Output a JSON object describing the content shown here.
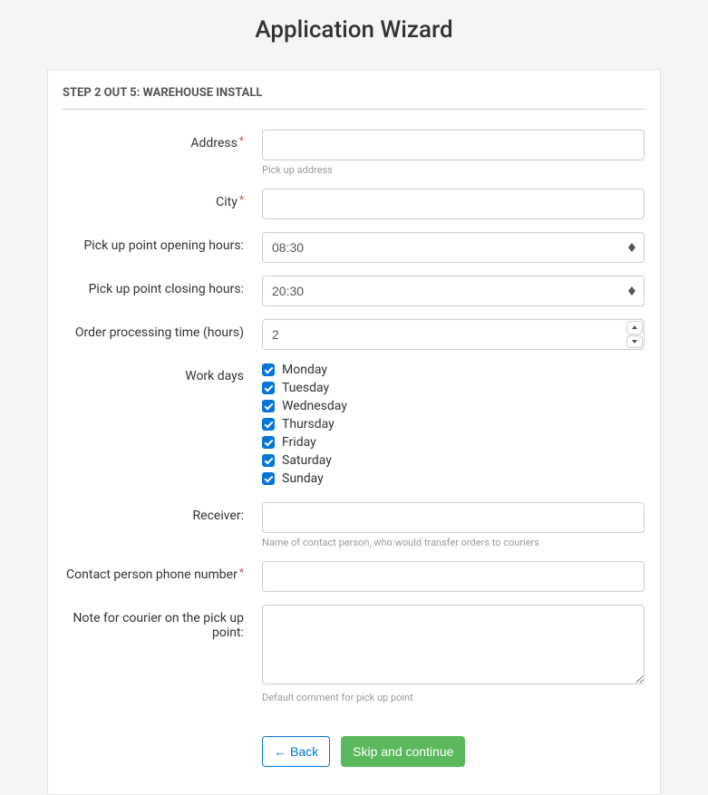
{
  "page_title": "Application Wizard",
  "step_header": "STEP 2 OUT 5: WAREHOUSE INSTALL",
  "form": {
    "address": {
      "label": "Address",
      "required": true,
      "value": "",
      "help": "Pick up address"
    },
    "city": {
      "label": "City",
      "required": true,
      "value": ""
    },
    "opening_hours": {
      "label": "Pick up point opening hours:",
      "selected": "08:30"
    },
    "closing_hours": {
      "label": "Pick up point closing hours:",
      "selected": "20:30"
    },
    "processing_time": {
      "label": "Order processing time (hours)",
      "value": "2"
    },
    "work_days": {
      "label": "Work days",
      "options": [
        {
          "label": "Monday",
          "checked": true
        },
        {
          "label": "Tuesday",
          "checked": true
        },
        {
          "label": "Wednesday",
          "checked": true
        },
        {
          "label": "Thursday",
          "checked": true
        },
        {
          "label": "Friday",
          "checked": true
        },
        {
          "label": "Saturday",
          "checked": true
        },
        {
          "label": "Sunday",
          "checked": true
        }
      ]
    },
    "receiver": {
      "label": "Receiver:",
      "value": "",
      "help": "Name of contact person, who would transfer orders to couriers"
    },
    "contact_phone": {
      "label": "Contact person phone number",
      "required": true,
      "value": ""
    },
    "note": {
      "label": "Note for courier on the pick up point:",
      "value": "",
      "help": "Default comment for pick up point"
    }
  },
  "buttons": {
    "back": "Back",
    "continue": "Skip and continue"
  }
}
